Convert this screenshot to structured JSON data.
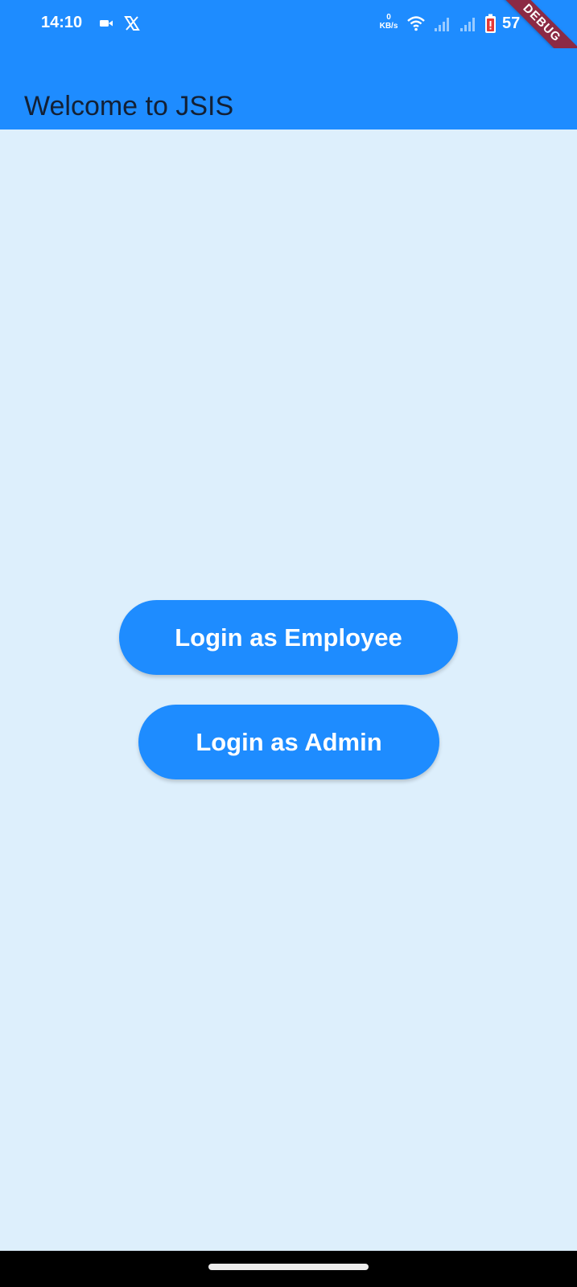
{
  "status_bar": {
    "time": "14:10",
    "net_speed_value": "0",
    "net_speed_unit": "KB/s",
    "battery_level": "57",
    "icons": [
      "video-camera-icon",
      "x-logo-icon",
      "wifi-icon",
      "signal-icon",
      "signal-icon",
      "battery-icon"
    ]
  },
  "app_bar": {
    "title": "Welcome to JSIS",
    "debug_banner": "DEBUG"
  },
  "main": {
    "employee_button_label": "Login as Employee",
    "admin_button_label": "Login as Admin"
  },
  "colors": {
    "primary": "#1e8cff",
    "background": "#ddeffc",
    "title_text": "#132034",
    "debug_banner": "#8c2a44",
    "battery_low": "#e53935"
  }
}
